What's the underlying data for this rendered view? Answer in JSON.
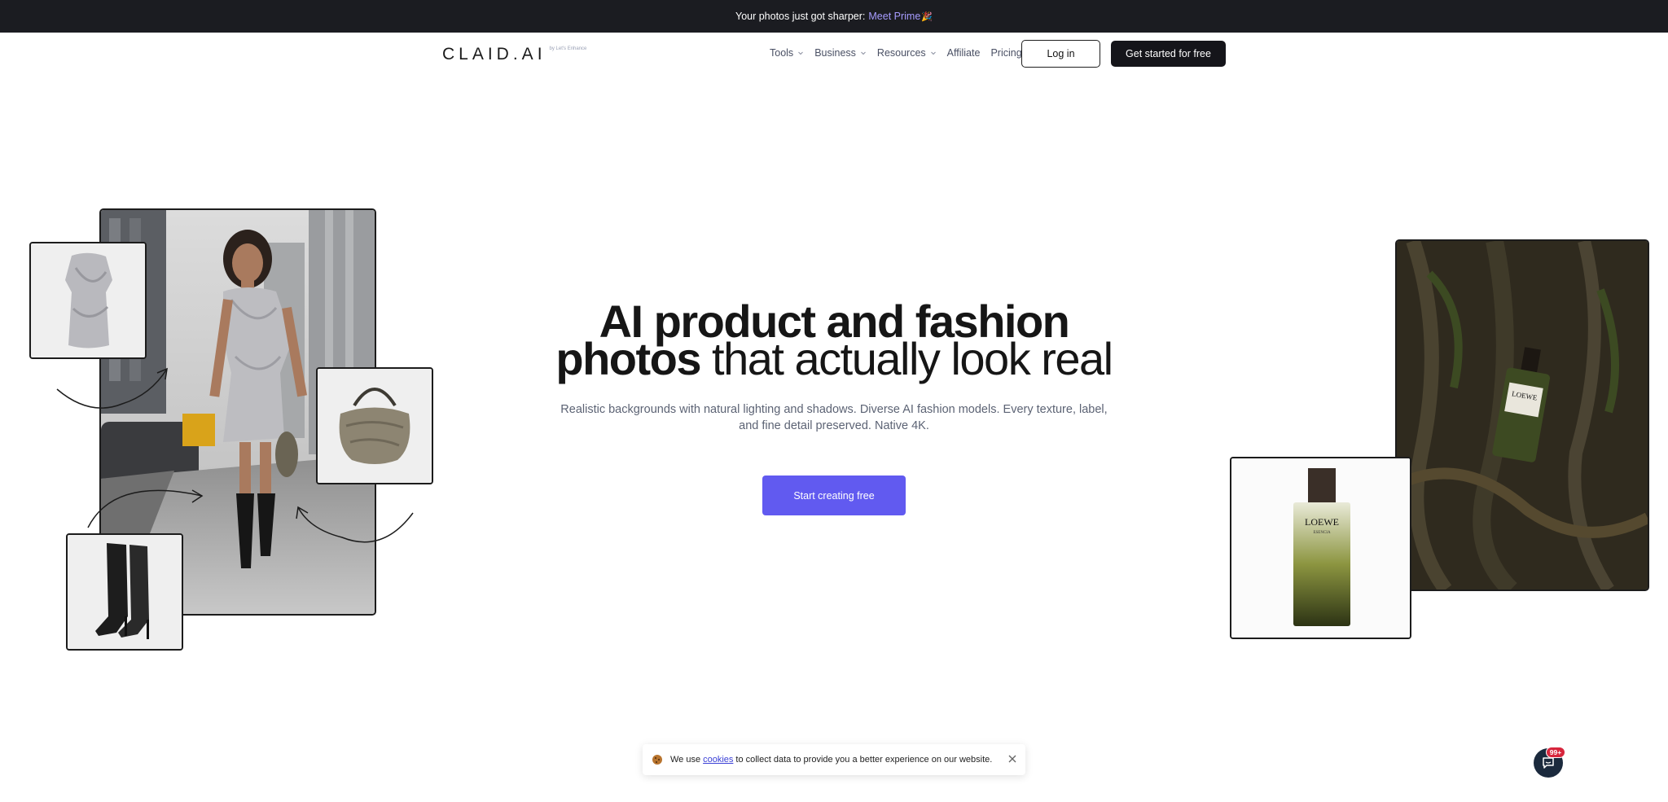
{
  "announcement": {
    "text": "Your photos just got sharper:",
    "link": "Meet Prime",
    "emoji": "🎉"
  },
  "nav": {
    "logo": "CLAID.AI",
    "logo_sub": "by Let's Enhance",
    "menu": [
      {
        "label": "Tools",
        "has_caret": true
      },
      {
        "label": "Business",
        "has_caret": true
      },
      {
        "label": "Resources",
        "has_caret": true
      },
      {
        "label": "Affiliate",
        "has_caret": false
      },
      {
        "label": "Pricing",
        "has_caret": false
      }
    ],
    "login": "Log in",
    "get_started": "Get started for free"
  },
  "hero": {
    "title_bold_1": "AI product and fashion",
    "title_bold_2": "photos",
    "title_light": " that actually look real",
    "subtitle": "Realistic backgrounds with natural lighting and shadows. Diverse AI fashion models. Every texture, label, and fine detail preserved. Native 4K.",
    "cta": "Start creating free"
  },
  "images": {
    "product_label": "LOEWE",
    "product_sub": "ESENCIA"
  },
  "cookie": {
    "text_before": "We use",
    "link": "cookies",
    "text_after": "to collect data to provide you a better experience on our website."
  },
  "chat": {
    "badge": "99+"
  },
  "colors": {
    "accent": "#615af0",
    "dark": "#15151a",
    "announce_bg": "#1b1c21",
    "link_purple": "#a79cff"
  }
}
